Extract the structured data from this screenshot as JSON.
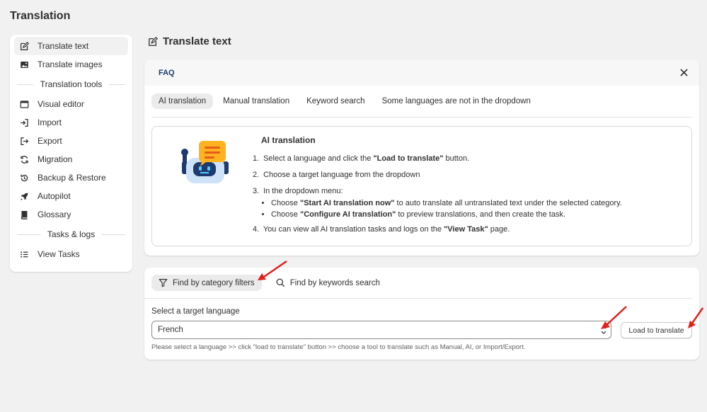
{
  "page": {
    "title": "Translation"
  },
  "sidebar": {
    "items_top": [
      {
        "label": "Translate text",
        "icon": "edit-icon"
      },
      {
        "label": "Translate images",
        "icon": "image-icon"
      }
    ],
    "group_tools": "Translation tools",
    "items_tools": [
      {
        "label": "Visual editor",
        "icon": "browser-icon"
      },
      {
        "label": "Import",
        "icon": "import-icon"
      },
      {
        "label": "Export",
        "icon": "export-icon"
      },
      {
        "label": "Migration",
        "icon": "refresh-icon"
      },
      {
        "label": "Backup & Restore",
        "icon": "history-icon"
      },
      {
        "label": "Autopilot",
        "icon": "rocket-icon"
      },
      {
        "label": "Glossary",
        "icon": "book-icon"
      }
    ],
    "group_tasks": "Tasks & logs",
    "items_tasks": [
      {
        "label": "View Tasks",
        "icon": "list-icon"
      }
    ]
  },
  "main": {
    "title": "Translate text",
    "faq": {
      "label": "FAQ",
      "tabs": [
        "AI translation",
        "Manual translation",
        "Keyword search",
        "Some languages are not in the dropdown"
      ],
      "ai_title": "AI translation",
      "step1_pre": "Select a language and click the ",
      "step1_bold": "\"Load to translate\"",
      "step1_post": " button.",
      "step2": "Choose a target language from the dropdown",
      "step3": "In the dropdown menu:",
      "sub1_pre": "Choose ",
      "sub1_bold": "\"Start AI translation now\"",
      "sub1_post": " to auto translate all untranslated text under the selected category.",
      "sub2_pre": "Choose ",
      "sub2_bold": "\"Configure AI translation\"",
      "sub2_post": " to preview translations, and then create the task.",
      "step4_pre": "You can view all AI translation tasks and logs on the ",
      "step4_bold": "\"View Task\"",
      "step4_post": " page.",
      "n1": "1.",
      "n2": "2.",
      "n3": "3.",
      "n4": "4."
    },
    "filter": {
      "mode_category": "Find by category filters",
      "mode_keywords": "Find by keywords search",
      "select_label": "Select a target language",
      "select_value": "French",
      "load_button": "Load to translate",
      "help": "Please select a language >> click \"load to translate\" button >> choose a tool to translate such as Manual, AI, or Import/Export."
    }
  },
  "colors": {
    "accent_arrow": "#e0201a",
    "faq_label": "#1a3d6e",
    "bg": "#f1f1f1"
  }
}
